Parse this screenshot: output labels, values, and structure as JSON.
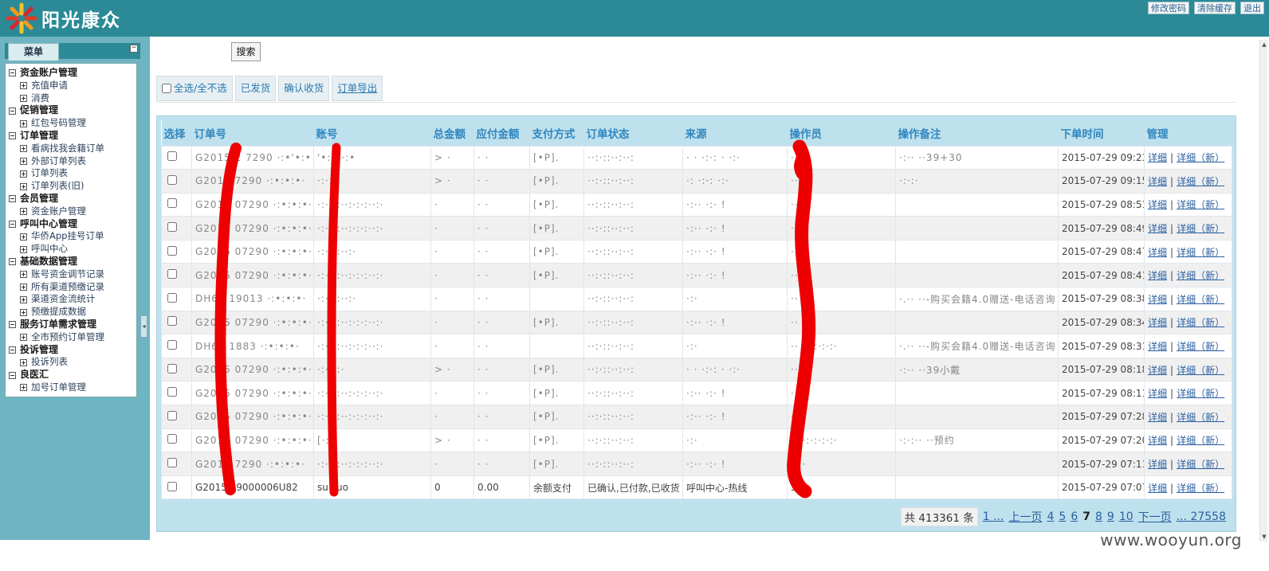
{
  "header": {
    "brand": "阳光康众",
    "links": [
      "修改密码",
      "清除缓存",
      "退出"
    ],
    "colors": {
      "bar": "#2b8a96"
    }
  },
  "sidebar": {
    "tab_label": "菜单",
    "collapse_icon": "minus-icon",
    "groups": [
      {
        "label": "资金账户管理",
        "items": [
          "充值申请",
          "消费"
        ]
      },
      {
        "label": "促销管理",
        "items": [
          "红包号码管理"
        ]
      },
      {
        "label": "订单管理",
        "items": [
          "看病找我会籍订单",
          "外部订单列表",
          "订单列表",
          "订单列表(旧)"
        ]
      },
      {
        "label": "会员管理",
        "items": [
          "资金账户管理"
        ]
      },
      {
        "label": "呼叫中心管理",
        "items": [
          "华侨App挂号订单",
          "呼叫中心"
        ]
      },
      {
        "label": "基础数据管理",
        "items": [
          "账号资金调节记录",
          "所有渠道预缴记录",
          "渠道资金流统计",
          "预缴提成数据"
        ]
      },
      {
        "label": "服务订单需求管理",
        "items": [
          "全市预约订单管理"
        ]
      },
      {
        "label": "投诉管理",
        "items": [
          "投诉列表"
        ]
      },
      {
        "label": "良医汇",
        "items": [
          "加号订单管理"
        ]
      }
    ]
  },
  "search": {
    "button_label": "搜索"
  },
  "actions": {
    "select_all": "全选/全不选",
    "shipped": "已发货",
    "confirm_receipt": "确认收货",
    "export": "订单导出"
  },
  "table": {
    "columns": [
      "选择",
      "订单号",
      "账号",
      "总金额",
      "应付金额",
      "支付方式",
      "订单状态",
      "来源",
      "操作员",
      "操作备注",
      "下单时间",
      "管理"
    ],
    "link_detail": "详细",
    "link_detail_new": "详细（新）",
    "rows": [
      {
        "order": "G2015 2 7290 ·:•'•:•",
        "account": "'•:·•·:•",
        "total": "> ·",
        "payable": "· ·",
        "pay": "[•P].",
        "status": "··:·::··:··:",
        "source": "· · ·:·: ·  ·:·",
        "operator": "·· ·",
        "remark": "·:·· ··39+30",
        "time": "2015-07-29 09:23"
      },
      {
        "order": "G2015 7290 ·:•:•:•·",
        "account": "·:·:··",
        "total": "> ·",
        "payable": "· ·",
        "pay": "[•P].",
        "status": "··:·::··:··:",
        "source": "·: ·:·:  ·:·",
        "operator": "·· ·",
        "remark": "·:·:·",
        "time": "2015-07-29 09:15"
      },
      {
        "order": "G2015 07290 ·:•:•:•·",
        "account": "·:·:·:··:·:·:··:·",
        "total": "·",
        "payable": "· ·",
        "pay": "[•P].",
        "status": "··:·::··:··:",
        "source": "·:·· ·:·  !",
        "operator": "·· ·",
        "remark": "",
        "time": "2015-07-29 08:51"
      },
      {
        "order": "G2015 07290 ·:•:•:•·",
        "account": "·:·:·:··:·:·:··:·",
        "total": "·",
        "payable": "· ·",
        "pay": "[•P].",
        "status": "··:·::··:··:",
        "source": "·:·· ·:·  !",
        "operator": "·· ·",
        "remark": "",
        "time": "2015-07-29 08:49"
      },
      {
        "order": "G2015 07290 ·:•:•:•·",
        "account": "·:·:·:··:·",
        "total": "·",
        "payable": "· ·",
        "pay": "[•P].",
        "status": "··:·::··:··:",
        "source": "·:·· ·:·  !",
        "operator": "·· ·",
        "remark": "",
        "time": "2015-07-29 08:47"
      },
      {
        "order": "G2015 07290 ·:•:•:•·",
        "account": "·:·:·:··:·:·:··:·",
        "total": "·",
        "payable": "· ·",
        "pay": "[•P].",
        "status": "··:·::··:··:",
        "source": "·:·· ·:·  !",
        "operator": "·· ·",
        "remark": "",
        "time": "2015-07-29 08:41"
      },
      {
        "order": "DH62 19013 ·:•:•:•·",
        "account": "·:·:·:··:·",
        "total": "·",
        "payable": "· ·",
        "pay": "",
        "status": "··:·::··:··:",
        "source": "·:·",
        "operator": "·· ·",
        "remark": "·.·· ··-购买会籍4.0赠送-电话咨询",
        "time": "2015-07-29 08:38"
      },
      {
        "order": "G2015 07290 ·:•:•:•·",
        "account": "·:·:·:··:·:·:··:·",
        "total": "·",
        "payable": "· ·",
        "pay": "[•P].",
        "status": "··:·::··:··:",
        "source": "·:·· ·:·  !",
        "operator": "·· ·",
        "remark": "",
        "time": "2015-07-29 08:34"
      },
      {
        "order": "DH62 1883 ·:•:•:•·",
        "account": "·:·:·:··:·:·:··:·",
        "total": "·",
        "payable": "· ·",
        "pay": "",
        "status": "··:·::··:··:",
        "source": "·:·",
        "operator": "·· ·:·:·:·:·",
        "remark": "·.·· ··-购买会籍4.0赠送-电话咨询",
        "time": "2015-07-29 08:31"
      },
      {
        "order": "G2015 07290 ·:•:•:•·",
        "account": "·:·:·:·",
        "total": "> ·",
        "payable": "· ·",
        "pay": "[•P].",
        "status": "··:·::··:··:",
        "source": "· · ·:·: ·  ·:·",
        "operator": "·· ·",
        "remark": "·:·· ··39小戴",
        "time": "2015-07-29 08:18"
      },
      {
        "order": "G2015 07290 ·:•:•:•·",
        "account": "·:·:·:··:·:·:··:·",
        "total": "·",
        "payable": "· ·",
        "pay": "[•P].",
        "status": "··:·::··:··:",
        "source": "·:·· ·:·  !",
        "operator": "·· ·",
        "remark": "",
        "time": "2015-07-29 08:11"
      },
      {
        "order": "G2015 07290 ·:•:•:•·",
        "account": "·:·:·:··:·:·:··:·",
        "total": "·",
        "payable": "· ·",
        "pay": "[•P].",
        "status": "··:·::··:··:",
        "source": "·:·· ·:·  !",
        "operator": "·· ·",
        "remark": "",
        "time": "2015-07-29 07:28"
      },
      {
        "order": "G2015 07290 ·:•:•:•·",
        "account": "[·:·]",
        "total": "> ·",
        "payable": "· ·",
        "pay": "[•P].",
        "status": "··:·::··:··:",
        "source": "·:·",
        "operator": "·· ·:·:·:·:·",
        "remark": "·:·:·· ··预约",
        "time": "2015-07-29 07:20"
      },
      {
        "order": "G2015 7290 ·:•:•:•·",
        "account": "·:·:·:··:·:·:··:·",
        "total": "·",
        "payable": "· ·",
        "pay": "[•P].",
        "status": "··:·::··:··:",
        "source": "·:·· ·:·  !",
        "operator": "·· ·",
        "remark": "",
        "time": "2015-07-29 07:11"
      },
      {
        "order": "G2015 09000006U82",
        "account": "su zuo",
        "total": "0",
        "payable": "0.00",
        "pay": "余额支付",
        "status": "已确认,已付款,已收货",
        "source": "呼叫中心-热线",
        "operator": "3",
        "remark": "",
        "time": "2015-07-29 07:07"
      }
    ]
  },
  "pager": {
    "total": "共 413361 条",
    "first": "1 ...",
    "prev": "上一页",
    "pages": [
      "4",
      "5",
      "6",
      "7",
      "8",
      "9",
      "10"
    ],
    "current": "7",
    "next": "下一页",
    "last": "... 27558"
  },
  "watermark": "www.wooyun.org"
}
